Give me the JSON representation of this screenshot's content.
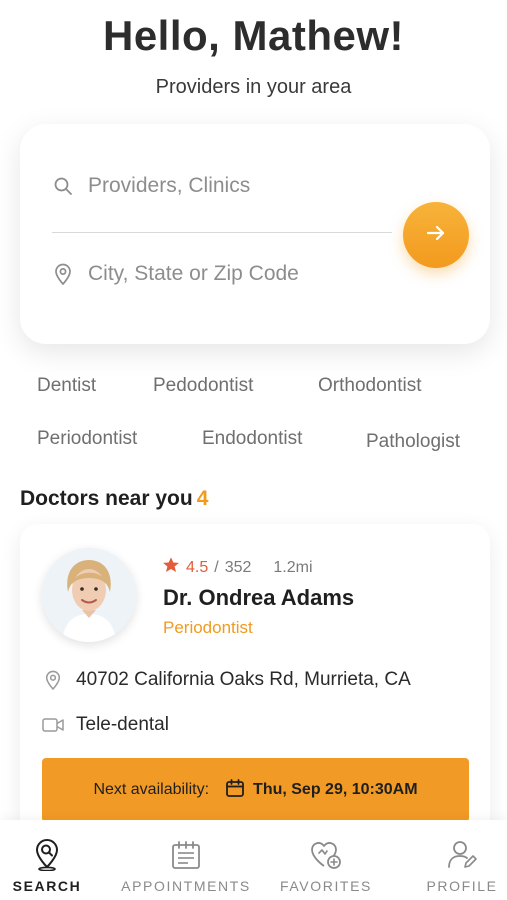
{
  "header": {
    "greeting": "Hello, Mathew!",
    "subtitle": "Providers in your area"
  },
  "search": {
    "provider_placeholder": "Providers, Clinics",
    "location_placeholder": "City, State or Zip Code",
    "submit_icon": "arrow-right-icon"
  },
  "specialties": [
    "Dentist",
    "Pedodontist",
    "Orthodontist",
    "Periodontist",
    "Endodontist",
    "Pathologist"
  ],
  "doctors_section": {
    "title": "Doctors near you",
    "count": "4"
  },
  "doctor": {
    "rating": "4.5",
    "reviews": "352",
    "separator": "/",
    "distance": "1.2mi",
    "name": "Dr. Ondrea Adams",
    "specialty": "Periodontist",
    "address": "40702 California Oaks Rd, Murrieta, CA",
    "visit_type": "Tele-dental",
    "availability_label": "Next availability:",
    "availability_time": "Thu, Sep 29, 10:30AM"
  },
  "tabs": [
    {
      "label": "SEARCH",
      "icon": "search-location-icon",
      "active": true
    },
    {
      "label": "APPOINTMENTS",
      "icon": "calendar-notes-icon",
      "active": false
    },
    {
      "label": "FAVORITES",
      "icon": "heart-plus-icon",
      "active": false
    },
    {
      "label": "PROFILE",
      "icon": "user-edit-icon",
      "active": false
    }
  ],
  "colors": {
    "accent": "#f29a1e",
    "rating": "#e45b3a",
    "text_dark": "#1f1f1f",
    "text_muted": "#8a8a8a"
  }
}
